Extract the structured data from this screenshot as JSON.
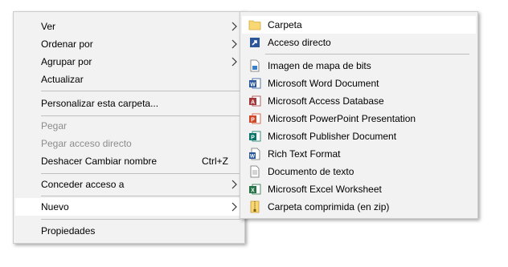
{
  "context_menu": {
    "items": [
      {
        "label": "Ver",
        "submenu": true
      },
      {
        "label": "Ordenar por",
        "submenu": true
      },
      {
        "label": "Agrupar por",
        "submenu": true
      },
      {
        "label": "Actualizar"
      },
      {
        "label": "Personalizar esta carpeta..."
      },
      {
        "label": "Pegar",
        "disabled": true
      },
      {
        "label": "Pegar acceso directo",
        "disabled": true
      },
      {
        "label": "Deshacer Cambiar nombre",
        "shortcut": "Ctrl+Z"
      },
      {
        "label": "Conceder acceso a",
        "submenu": true
      },
      {
        "label": "Nuevo",
        "submenu": true,
        "highlighted": true
      },
      {
        "label": "Propiedades"
      }
    ]
  },
  "new_submenu": {
    "items": [
      {
        "label": "Carpeta",
        "icon": "folder-icon"
      },
      {
        "label": "Acceso directo",
        "icon": "shortcut-icon"
      },
      {
        "label": "Imagen de mapa de bits",
        "icon": "bitmap-image-icon"
      },
      {
        "label": "Microsoft Word Document",
        "icon": "word-icon"
      },
      {
        "label": "Microsoft Access Database",
        "icon": "access-icon"
      },
      {
        "label": "Microsoft PowerPoint Presentation",
        "icon": "powerpoint-icon"
      },
      {
        "label": "Microsoft Publisher Document",
        "icon": "publisher-icon"
      },
      {
        "label": "Rich Text Format",
        "icon": "rtf-icon"
      },
      {
        "label": "Documento de texto",
        "icon": "text-document-icon"
      },
      {
        "label": "Microsoft Excel Worksheet",
        "icon": "excel-icon"
      },
      {
        "label": "Carpeta comprimida (en zip)",
        "icon": "zip-folder-icon"
      }
    ]
  },
  "colors": {
    "menu_bg": "#f2f2f2",
    "highlight_bg": "#ffffff",
    "disabled_text": "#8c8c8c",
    "word_blue": "#2b579a",
    "access_red": "#a4373a",
    "powerpoint_orange": "#d24726",
    "publisher_teal": "#077568",
    "excel_green": "#217346",
    "folder_yellow": "#f8d775"
  }
}
